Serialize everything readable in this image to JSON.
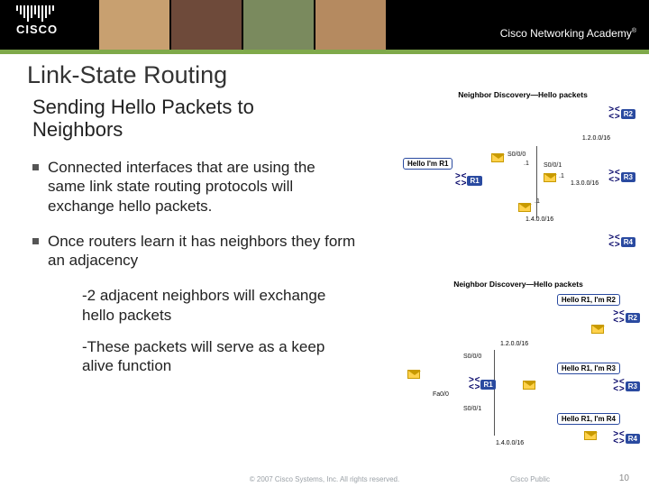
{
  "brand": {
    "name": "CISCO",
    "program": "Cisco Networking Academy",
    "tm": "®"
  },
  "title": "Link-State Routing",
  "subtitle": "Sending Hello Packets to Neighbors",
  "bullets": [
    "Connected interfaces that are using the same link state routing protocols will exchange hello packets.",
    "Once routers learn it has neighbors they form an adjacency"
  ],
  "subpoints": [
    "-2 adjacent neighbors will exchange hello packets",
    "-These packets will serve as a keep alive function"
  ],
  "diagram1": {
    "caption": "Neighbor Discovery—Hello packets",
    "hello": "Hello I'm R1",
    "routers": {
      "r1": "R1",
      "r2": "R2",
      "r3": "R3",
      "r4": "R4"
    },
    "nets": {
      "n12": "1.2.0.0/16",
      "n13": "1.3.0.0/16",
      "n14": "1.4.0.0/16"
    },
    "ifs": {
      "a": "S0/0/0",
      "b": "S0/0/1",
      "c": ".1",
      "d": ".1",
      "e": ".1"
    }
  },
  "diagram2": {
    "caption": "Neighbor Discovery—Hello packets",
    "hellos": {
      "r2": "Hello R1, I'm R2",
      "r3": "Hello R1, I'm R3",
      "r4": "Hello R1, I'm R4"
    },
    "routers": {
      "r1": "R1",
      "r2": "R2",
      "r3": "R3",
      "r4": "R4"
    },
    "nets": {
      "n12": "1.2.0.0/16",
      "n14": "1.4.0.0/16"
    },
    "ifs": {
      "s0": "S0/0/0",
      "s1": "S0/0/1",
      "f0": "Fa0/0"
    }
  },
  "footer": {
    "copyright": "© 2007 Cisco Systems, Inc. All rights reserved.",
    "classification": "Cisco Public",
    "page": "10"
  }
}
